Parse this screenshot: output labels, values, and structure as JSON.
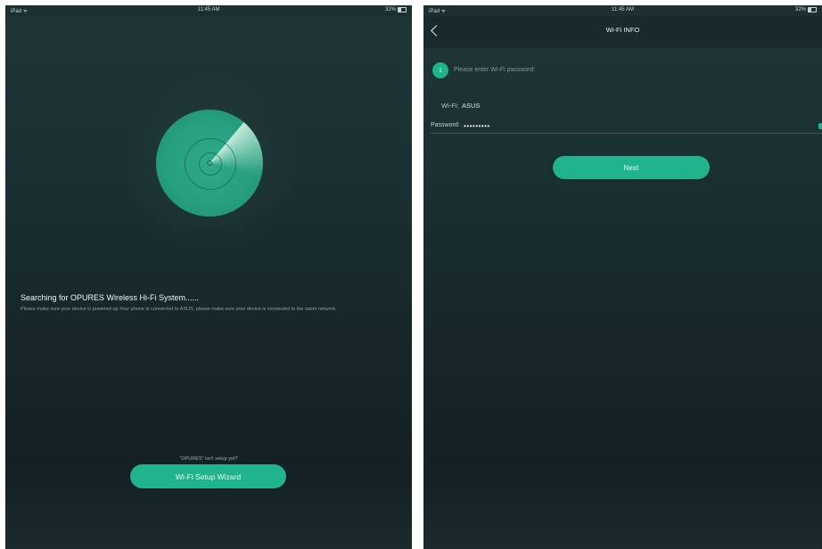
{
  "left_screen": {
    "status_bar": {
      "carrier": "iPad ᯤ",
      "time": "11:45 AM",
      "battery": "32%"
    },
    "search_title": "Searching for OPURES Wireless Hi-Fi System......",
    "search_description": "Please make sure your device is powered up.Your phone is connected to ASUS, please make sure your device is connected to the same network.",
    "not_setup_text": "\"OPURES\" isn't setup yet?",
    "wizard_button": "Wi-Fi Setup Wizard"
  },
  "right_screen": {
    "status_bar": {
      "carrier": "iPad ᯤ",
      "time": "11:45 AM",
      "battery": "32%"
    },
    "nav_title": "Wi-Fi INFO",
    "step_number": "1",
    "step_text": "Please enter Wi-Fi password:",
    "wifi_label": "Wi-Fi:",
    "wifi_value": "ASUS",
    "password_label": "Password:",
    "password_value": "•••••••••",
    "next_button": "Next"
  },
  "colors": {
    "accent": "#20b48e",
    "background_top": "#1f3536",
    "background_bottom": "#132124"
  },
  "icons": {
    "back": "chevron-left-icon",
    "radar": "radar-icon",
    "wifi": "wifi-icon",
    "battery": "battery-icon"
  }
}
